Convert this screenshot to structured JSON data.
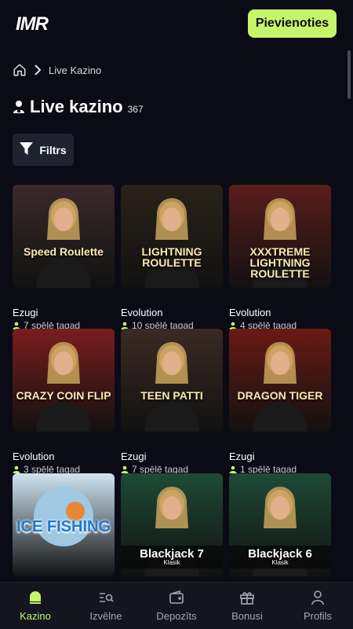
{
  "header": {
    "logo": "IMR",
    "join_label": "Pievienoties"
  },
  "breadcrumb": {
    "current": "Live Kazino"
  },
  "page": {
    "title": "Live kazino",
    "count": "367",
    "filter_label": "Filtrs"
  },
  "games": [
    {
      "provider": "Ezugi",
      "players": "7 spēlē tagad",
      "title": "Speed Roulette",
      "bg": "#3a2a2a"
    },
    {
      "provider": "Evolution",
      "players": "10 spēlē tagad",
      "title": "LIGHTNING ROULETTE",
      "bg": "#2a2218"
    },
    {
      "provider": "Evolution",
      "players": "4 spēlē tagad",
      "title": "XXXTREME LIGHTNING ROULETTE",
      "bg": "#5a1e1a"
    },
    {
      "provider": "Evolution",
      "players": "3 spēlē tagad",
      "title": "CRAZY COIN FLIP",
      "bg": "#7a1d1d"
    },
    {
      "provider": "Ezugi",
      "players": "7 spēlē tagad",
      "title": "TEEN PATTI",
      "bg": "#3a2a22"
    },
    {
      "provider": "Ezugi",
      "players": "1 spēlē tagad",
      "title": "DRAGON TIGER",
      "bg": "#6a1a12"
    },
    {
      "provider": "",
      "players": "",
      "title": "ICE FISHING",
      "bg": "#cfe4f2"
    },
    {
      "provider": "",
      "players": "",
      "title": "Blackjack 7",
      "bg": "#1e4a36"
    },
    {
      "provider": "",
      "players": "",
      "title": "Blackjack 6",
      "bg": "#1e4a36"
    }
  ],
  "blackjack_sub": "Klasik",
  "nav": [
    {
      "label": "Kazino",
      "icon": "home-icon"
    },
    {
      "label": "Izvēlne",
      "icon": "menu-search-icon"
    },
    {
      "label": "Depozīts",
      "icon": "wallet-icon"
    },
    {
      "label": "Bonusi",
      "icon": "gift-icon"
    },
    {
      "label": "Profils",
      "icon": "user-icon"
    }
  ],
  "colors": {
    "accent": "#c5f56b",
    "background": "#0b0b16",
    "card": "#1f2330"
  }
}
